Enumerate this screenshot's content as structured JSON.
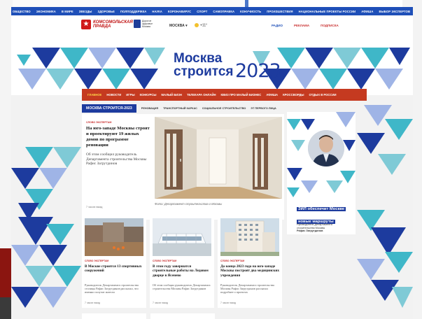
{
  "topnav": [
    "ОБЩЕСТВО",
    "ЭКОНОМИКА",
    "В МИРЕ",
    "ЗВЕЗДЫ",
    "ЗДОРОВЬЕ",
    "ПОЛПОДДЕРЖКА",
    "НАУКА",
    "КОРОНАВИРУС",
    "СПОРТ",
    "САМОПРАВКА",
    "КОНУЧИОСТЬ",
    "ПРОИЗШЕСТВИЯ",
    "НАЦИОНАЛЬНЫЕ ПРОЕКТЫ РОССИИ",
    "АФИША",
    "ВЫБОР ЭКСПЕРТОВ"
  ],
  "header": {
    "logo_name": "КОМСОМОЛЬСКАЯ ПРАВДА",
    "partner_text": "Дорогое здоровье Москва",
    "city": "МОСКВА",
    "weather": "+11°",
    "links": [
      "РАДИО",
      "РЕКЛАМА",
      "ПОДПИСКА"
    ]
  },
  "banner": {
    "line1": "Москва",
    "line2": "строится",
    "year": "2023"
  },
  "menu": [
    "ГЛАВНОЕ",
    "НОВОСТИ",
    "ИГРЫ",
    "КОНКУРСЫ",
    "МАЛЫЙ БИЗН",
    "ТЕЛЕКАРА ОНЛАЙН",
    "КВИЗ ПРО МАЛЫЙ БИЗНЕС",
    "АФИША",
    "КРОССВОРДЫ",
    "ОТДЫХ В РОССИИ"
  ],
  "subnav": {
    "tag": "МОСКВА СТРОИТСЯ-2023",
    "items": [
      "РЕНОВАЦИЯ",
      "ТРАНСПОРТНЫЙ КАРКАС",
      "СОЦИАЛЬНОЕ СТРОИТЕЛЬСТВО",
      "ЭТ ПЕРВОГО ЛИЦА"
    ]
  },
  "lead": {
    "label": "СЛОВО ЭКСПЕРТАМ",
    "title": "На юго-западе Москвы строят и проектируют 19 жилых домов по программе реновации",
    "desc": "Об этом сообщил руководитель Департамента строительства Москвы Рафис Загрутдинов",
    "time": "7 часов назад",
    "caption": "Фото: Департамент строительства г.Москвы"
  },
  "side": {
    "headline": "ЗИЛ обеспечит Москве новые маршруты",
    "who_role": "Руководитель Департамента строительства Москвы",
    "who_name": "Рафис Загрутдинов"
  },
  "cards": [
    {
      "label": "СЛОВО ЭКСПЕРТАМ",
      "title": "В Москве строится 13 спортивных сооружений",
      "desc": "Руководитель Департамента строительства столицы Рафис Загрутдинов рассказал, что именно получат жители",
      "time": "7 часов назад"
    },
    {
      "label": "СЛОВО ЭКСПЕРТАМ",
      "title": "В этом году завершатся строительные работы на Ледовом дворце в Ясенево",
      "desc": "Об этом сообщил руководитель Департамента строительства Москвы Рафис Загрутдинов",
      "time": "7 часов назад"
    },
    {
      "label": "СЛОВО ЭКСПЕРТАМ",
      "title": "До конца 2023 года на юго-западе Москвы построят два медицинских учреждения",
      "desc": "Руководитель Департамента строительства Москвы Рафис Загрутдинов рассказал подробнее о проектах",
      "time": "7 часов назад"
    }
  ],
  "colors": {
    "brand_blue": "#1d3b9e",
    "nav_blue": "#1e4fb8",
    "menu_red": "#c53a20",
    "accent_teal": "#3fb7c8"
  }
}
